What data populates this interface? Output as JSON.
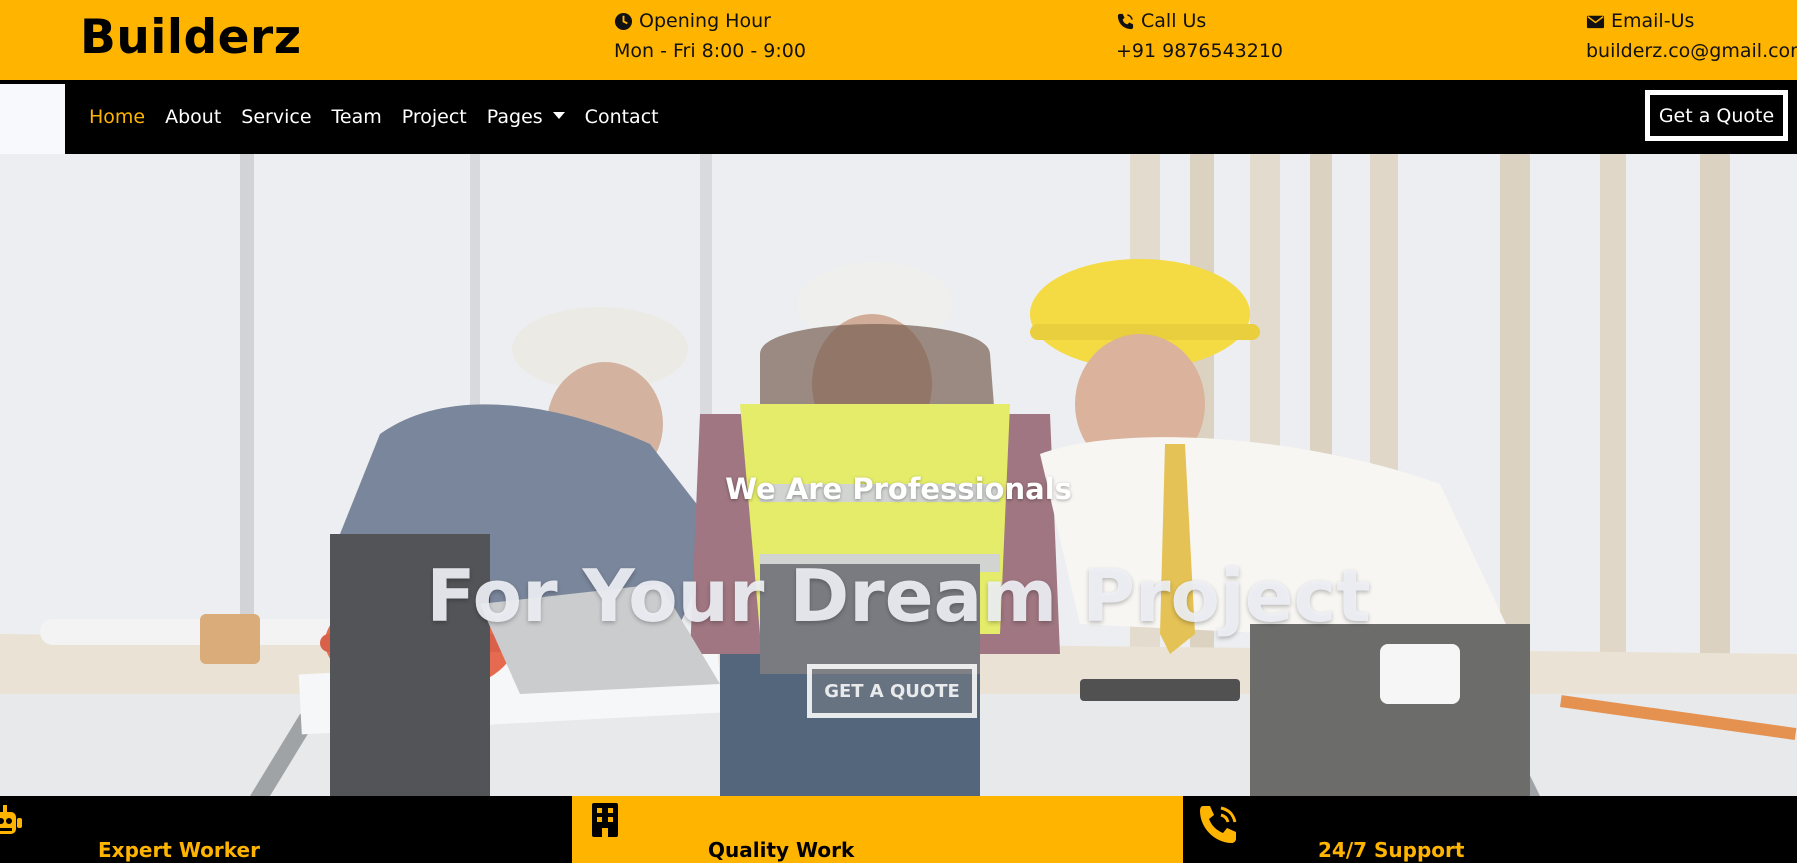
{
  "brand": "Builderz",
  "topbar": {
    "opening": {
      "icon": "clock-icon",
      "label": "Opening Hour",
      "value": "Mon - Fri 8:00 - 9:00"
    },
    "call": {
      "icon": "phone-icon",
      "label": "Call Us",
      "value": "+91 9876543210"
    },
    "email": {
      "icon": "envelope-icon",
      "label": "Email-Us",
      "value": "builderz.co@gmail.com"
    }
  },
  "nav": {
    "items": [
      {
        "label": "Home",
        "active": true
      },
      {
        "label": "About"
      },
      {
        "label": "Service"
      },
      {
        "label": "Team"
      },
      {
        "label": "Project"
      },
      {
        "label": "Pages",
        "dropdown": true
      },
      {
        "label": "Contact"
      }
    ],
    "cta": "Get a Quote"
  },
  "hero": {
    "subtitle": "We Are Professionals",
    "title": "For Your Dream Project",
    "button": "GET A QUOTE"
  },
  "features": [
    {
      "icon": "robot-icon",
      "label": "Expert Worker"
    },
    {
      "icon": "building-icon",
      "label": "Quality Work"
    },
    {
      "icon": "phone-volume-icon",
      "label": "24/7 Support"
    }
  ],
  "colors": {
    "accent": "#ffb400",
    "dark": "#000000",
    "light": "#ffffff"
  }
}
